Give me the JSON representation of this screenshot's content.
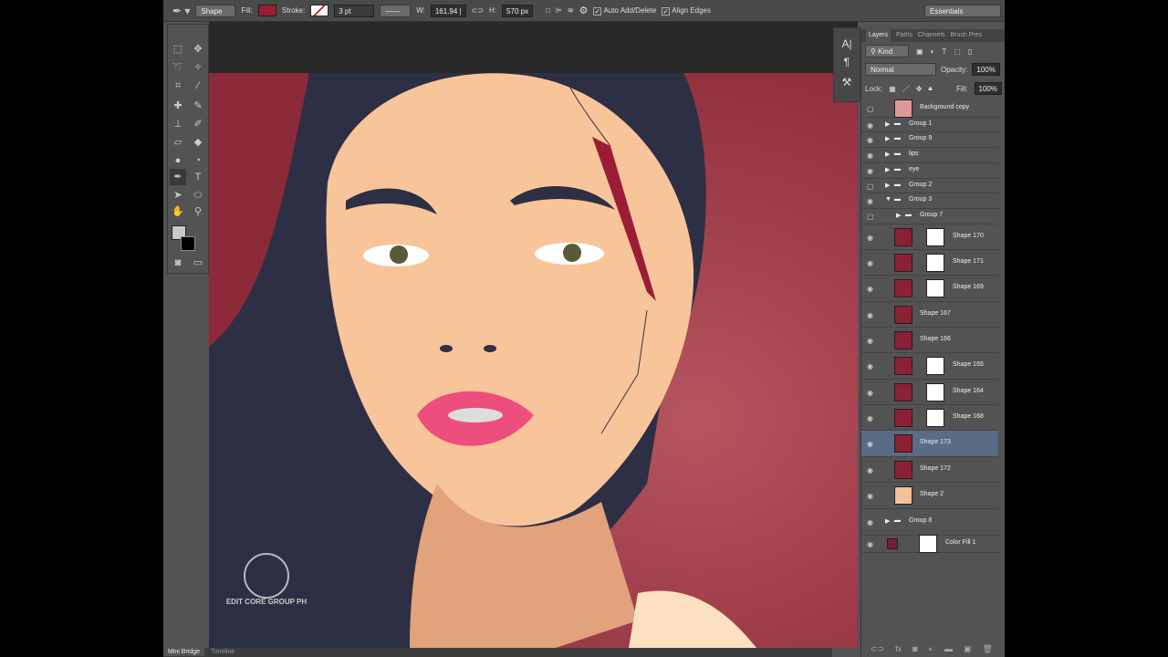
{
  "options": {
    "tool_icon": "pen-icon",
    "mode": "Shape",
    "fill_label": "Fill:",
    "fill_color": "#9b1d35",
    "stroke_label": "Stroke:",
    "stroke_width": "3 pt",
    "w_label": "W:",
    "w_value": "161.94 |",
    "h_label": "H:",
    "h_value": "570 px",
    "auto_add_delete": "Auto Add/Delete",
    "align_edges": "Align Edges",
    "workspace": "Essentials"
  },
  "bottom_tabs": [
    "Mini Bridge",
    "Timeline"
  ],
  "panel": {
    "tabs": [
      "Layers",
      "Paths",
      "Channels",
      "Brush Pres"
    ],
    "kind": "Kind",
    "blend": "Normal",
    "opacity_label": "Opacity:",
    "opacity": "100%",
    "lock_label": "Lock:",
    "fill_label": "Fill:",
    "fill": "100%"
  },
  "layers": [
    {
      "name": "Background copy",
      "type": "image",
      "visible": false
    },
    {
      "name": "Group 1",
      "type": "group"
    },
    {
      "name": "Group 9",
      "type": "group"
    },
    {
      "name": "lips",
      "type": "group"
    },
    {
      "name": "eye",
      "type": "group"
    },
    {
      "name": "Group 2",
      "type": "group",
      "visible": false
    },
    {
      "name": "Group 3",
      "type": "group-open"
    },
    {
      "name": "Group 7",
      "type": "group",
      "visible": false
    },
    {
      "name": "Shape 170",
      "type": "shape"
    },
    {
      "name": "Shape 171",
      "type": "shape"
    },
    {
      "name": "Shape 169",
      "type": "shape"
    },
    {
      "name": "Shape 167",
      "type": "shape"
    },
    {
      "name": "Shape 166",
      "type": "shape"
    },
    {
      "name": "Shape 165",
      "type": "shape"
    },
    {
      "name": "Shape 164",
      "type": "shape"
    },
    {
      "name": "Shape 168",
      "type": "shape"
    },
    {
      "name": "Shape 173",
      "type": "shape",
      "selected": true
    },
    {
      "name": "Shape 172",
      "type": "shape"
    },
    {
      "name": "Shape 2",
      "type": "shape"
    },
    {
      "name": "Group 8",
      "type": "group"
    },
    {
      "name": "Color Fill 1",
      "type": "fill"
    }
  ],
  "watermark": "EDIT CORE GROUP PH"
}
